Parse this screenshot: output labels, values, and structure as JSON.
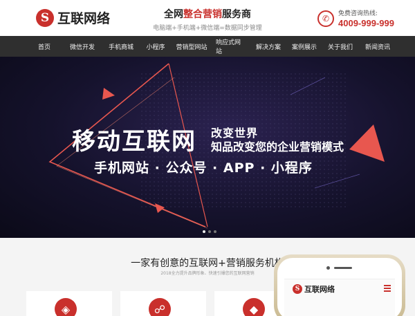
{
  "header": {
    "logo_mark": "S",
    "logo_text": "互联网络",
    "slogan_prefix": "全网",
    "slogan_highlight": "整合营销",
    "slogan_suffix": "服务商",
    "slogan_sub": "电脑端+手机端+微信端=数据同步管理",
    "hotline_label": "免费咨询热线:",
    "hotline_number": "4009-999-999"
  },
  "nav": {
    "items": [
      {
        "label": "首页"
      },
      {
        "label": "微信开发"
      },
      {
        "label": "手机商城"
      },
      {
        "label": "小程序"
      },
      {
        "label": "营销型网站"
      },
      {
        "label": "响应式网站"
      },
      {
        "label": "解决方案"
      },
      {
        "label": "案例展示"
      },
      {
        "label": "关于我们"
      },
      {
        "label": "新闻资讯"
      }
    ]
  },
  "banner": {
    "title": "移动互联网",
    "sub1": "改变世界",
    "sub2": "知品改变您的企业营销模式",
    "tags": "手机网站 · 公众号 · APP · 小程序",
    "slides": 3,
    "active_slide": 1
  },
  "intro": {
    "title": "一家有创意的互联网+营销服务机构",
    "subtitle": "2018全力提升品牌形象、快速引爆您的互联网营销",
    "cards": [
      {
        "icon": "chat-icon"
      },
      {
        "icon": "cart-icon"
      },
      {
        "icon": "target-icon"
      }
    ]
  },
  "phone": {
    "logo_text": "互联网络"
  },
  "colors": {
    "accent": "#c9302c",
    "nav_bg": "#2f2f2f",
    "banner_bg": "#15122c",
    "triangle": "#e8574f"
  }
}
